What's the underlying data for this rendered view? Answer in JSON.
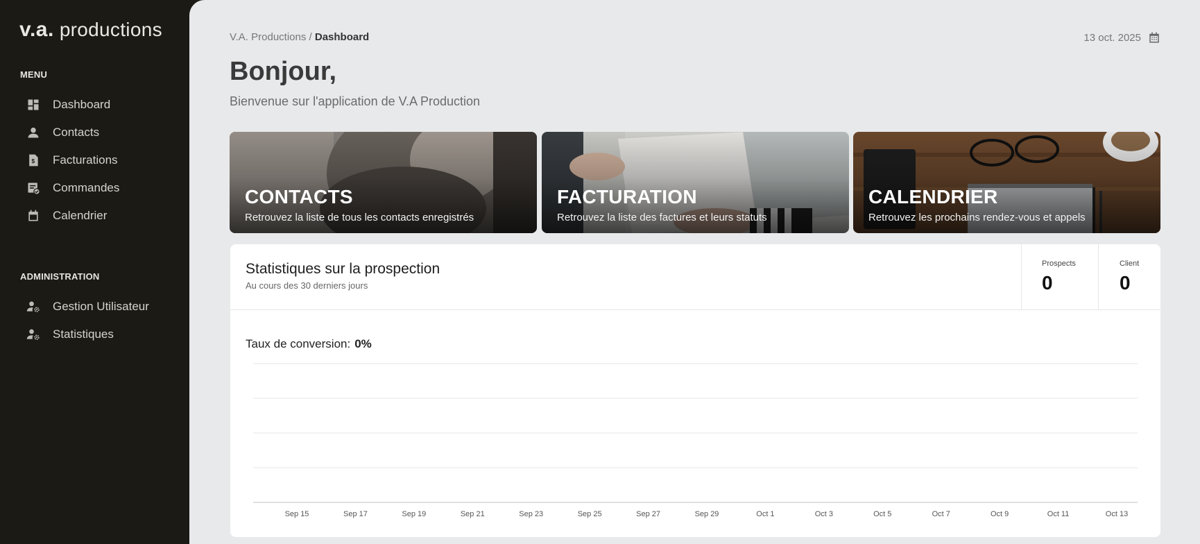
{
  "sidebar": {
    "logo_bold": "v.a.",
    "logo_light": "productions",
    "menu_title": "MENU",
    "menu_items": [
      {
        "label": "Dashboard",
        "icon": "dashboard-icon"
      },
      {
        "label": "Contacts",
        "icon": "user-icon"
      },
      {
        "label": "Facturations",
        "icon": "invoice-icon"
      },
      {
        "label": "Commandes",
        "icon": "order-check-icon"
      },
      {
        "label": "Calendrier",
        "icon": "calendar-icon"
      }
    ],
    "admin_title": "ADMINISTRATION",
    "admin_items": [
      {
        "label": "Gestion Utilisateur",
        "icon": "user-gear-icon"
      },
      {
        "label": "Statistiques",
        "icon": "user-gear-icon"
      }
    ]
  },
  "header": {
    "breadcrumb_root": "V.A. Productions",
    "breadcrumb_separator": " / ",
    "breadcrumb_current": "Dashboard",
    "date": "13 oct. 2025",
    "greeting": "Bonjour,",
    "subtitle": "Bienvenue sur l'application de V.A Production"
  },
  "cards": [
    {
      "title": "CONTACTS",
      "description": "Retrouvez la liste de tous les contacts enregistrés"
    },
    {
      "title": "FACTURATION",
      "description": "Retrouvez la liste des factures et leurs statuts"
    },
    {
      "title": "CALENDRIER",
      "description": "Retrouvez les prochains rendez-vous et appels"
    }
  ],
  "stats": {
    "title": "Statistiques sur la prospection",
    "subtitle": "Au cours des 30 derniers jours",
    "prospects_label": "Prospects",
    "prospects_value": "0",
    "client_label": "Client",
    "client_value": "0",
    "conversion_label": "Taux de conversion:",
    "conversion_value": "0%"
  },
  "chart_data": {
    "type": "line",
    "categories": [
      "Sep 15",
      "Sep 17",
      "Sep 19",
      "Sep 21",
      "Sep 23",
      "Sep 25",
      "Sep 27",
      "Sep 29",
      "Oct 1",
      "Oct 3",
      "Oct 5",
      "Oct 7",
      "Oct 9",
      "Oct 11",
      "Oct 13"
    ],
    "series": [
      {
        "values": [
          0,
          0,
          0,
          0,
          0,
          0,
          0,
          0,
          0,
          0,
          0,
          0,
          0,
          0,
          0
        ]
      }
    ],
    "grid": true,
    "gridline_count": 5,
    "colors": {
      "grid": "#e4e4e4",
      "axis": "#d6d6d6"
    }
  }
}
